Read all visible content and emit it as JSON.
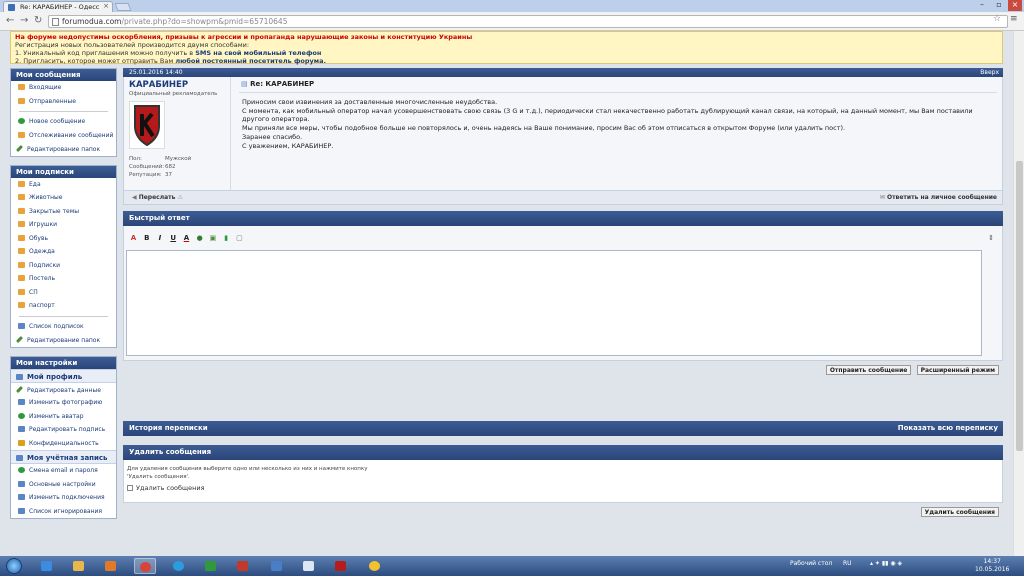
{
  "browser": {
    "tab_title": "Re: КАРАБИНЕР - Одесс",
    "url_host": "forumodua.com",
    "url_path": "/private.php?do=showpm&pmid=65710645"
  },
  "notice": {
    "line1": "На форуме недопустимы оскорбления, призывы к агрессии и пропаганда нарушающие законы и конституцию Украины",
    "line2": "Регистрация новых пользователей производится двумя способами:",
    "line3_pre": "1. Уникальный код приглашения можно получить в ",
    "line3_link": "SMS на свой мобильный телефон",
    "line4_pre": "2. Пригласить, которое может отправить Вам ",
    "line4_link": "любой постоянный посетитель форума."
  },
  "sidebar": {
    "messages_title": "Мои сообщения",
    "messages_items": [
      "Входящие",
      "Отправленные"
    ],
    "messages_actions": [
      "Новое сообщение",
      "Отслеживание сообщений",
      "Редактирование папок"
    ],
    "subs_title": "Мои подписки",
    "subs_items": [
      "Еда",
      "Животные",
      "Закрытые темы",
      "Игрушки",
      "Обувь",
      "Одежда",
      "Подписки",
      "Постель",
      "СП",
      "паспорт"
    ],
    "subs_actions": [
      "Список подписок",
      "Редактирование папок"
    ],
    "settings_title": "Мои настройки",
    "profile_title": "Мой профиль",
    "profile_items": [
      "Редактировать данные",
      "Изменить фотографию",
      "Изменить аватар",
      "Редактировать подпись",
      "Конфиденциальность"
    ],
    "account_title": "Моя учётная запись",
    "account_items": [
      "Смена email и пароля",
      "Основные настройки",
      "Изменить подключения",
      "Список игнорирования"
    ]
  },
  "post": {
    "date": "25.01.2016 14:40",
    "up_label": "Вверх",
    "author": "КАРАБИНЕР",
    "author_title": "Официальный рекламодатель",
    "stats": [
      {
        "k": "Пол:",
        "v": "Мужской"
      },
      {
        "k": "Сообщений:",
        "v": "682"
      },
      {
        "k": "Репутация:",
        "v": "37"
      }
    ],
    "title": "Re: КАРАБИНЕР",
    "body": [
      "Приносим свои извинения за доставленные многочисленные неудобства.",
      "С момента, как мобильный оператор начал усовершенствовать свою связь (3 G и т.д.), периодически стал некачественно работать дублирующий канал связи, на который, на данный момент, мы Вам поставили другого оператора.",
      "Мы приняли все меры, чтобы подобное больше не повторялось и, очень надеясь на Ваше понимание, просим Вас об этом отписаться в открытом Форуме (или удалить пост).",
      "Заранее спасибо.",
      "С уважением, КАРАБИНЕР."
    ],
    "forward_label": "Переслать",
    "reply_label": "Ответить на личное сообщение"
  },
  "quick_reply": {
    "title": "Быстрый ответ",
    "send_label": "Отправить сообщение",
    "advanced_label": "Расширенный режим"
  },
  "history": {
    "title": "История переписки",
    "show_all": "Показать всю переписку"
  },
  "delete": {
    "title": "Удалить сообщения",
    "description": "Для удаления сообщения выберите одно или несколько из них и нажмите кнопку 'Удалить сообщения'.",
    "checkbox_label": "Удалить сообщения",
    "button_label": "Удалить сообщения"
  },
  "taskbar": {
    "desktop_label": "Рабочий стол",
    "lang": "RU",
    "time": "14:37",
    "date": "10.05.2016"
  },
  "colors": {
    "header_blue": "#2a4578",
    "notice_bg": "#fff6c4",
    "link": "#1a3a7a"
  }
}
